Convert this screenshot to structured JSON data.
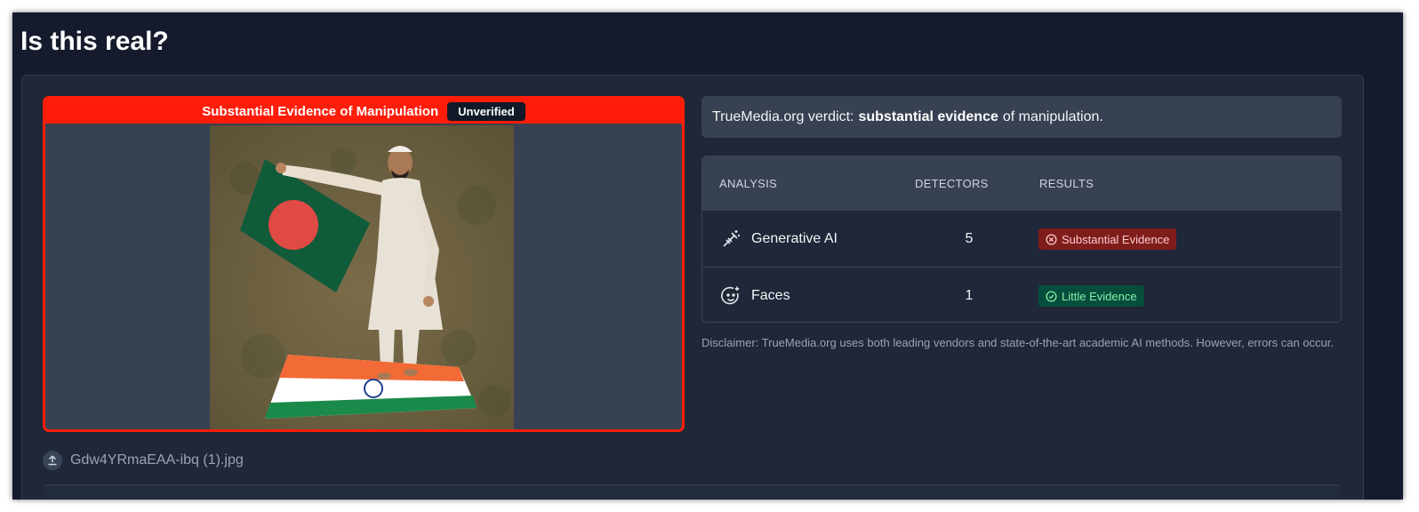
{
  "page": {
    "title": "Is this real?"
  },
  "media": {
    "banner_text": "Substantial Evidence of Manipulation",
    "badge": "Unverified",
    "file_name": "Gdw4YRmaEAA-ibq (1).jpg",
    "border_color": "#ff1d0a"
  },
  "verdict": {
    "prefix": "TrueMedia.org verdict:",
    "emphasis": "substantial evidence",
    "suffix": "of manipulation."
  },
  "analysis": {
    "headers": {
      "analysis": "ANALYSIS",
      "detectors": "DETECTORS",
      "results": "RESULTS"
    },
    "rows": [
      {
        "icon": "magic-wand-icon",
        "name": "Generative AI",
        "detectors": "5",
        "result": "Substantial Evidence",
        "result_icon": "x-circle-icon",
        "status_color": "#7f1d1d"
      },
      {
        "icon": "face-icon",
        "name": "Faces",
        "detectors": "1",
        "result": "Little Evidence",
        "result_icon": "check-circle-icon",
        "status_color": "#064e3b"
      }
    ]
  },
  "disclaimer": "Disclaimer: TrueMedia.org uses both leading vendors and state-of-the-art academic AI methods. However, errors can occur."
}
